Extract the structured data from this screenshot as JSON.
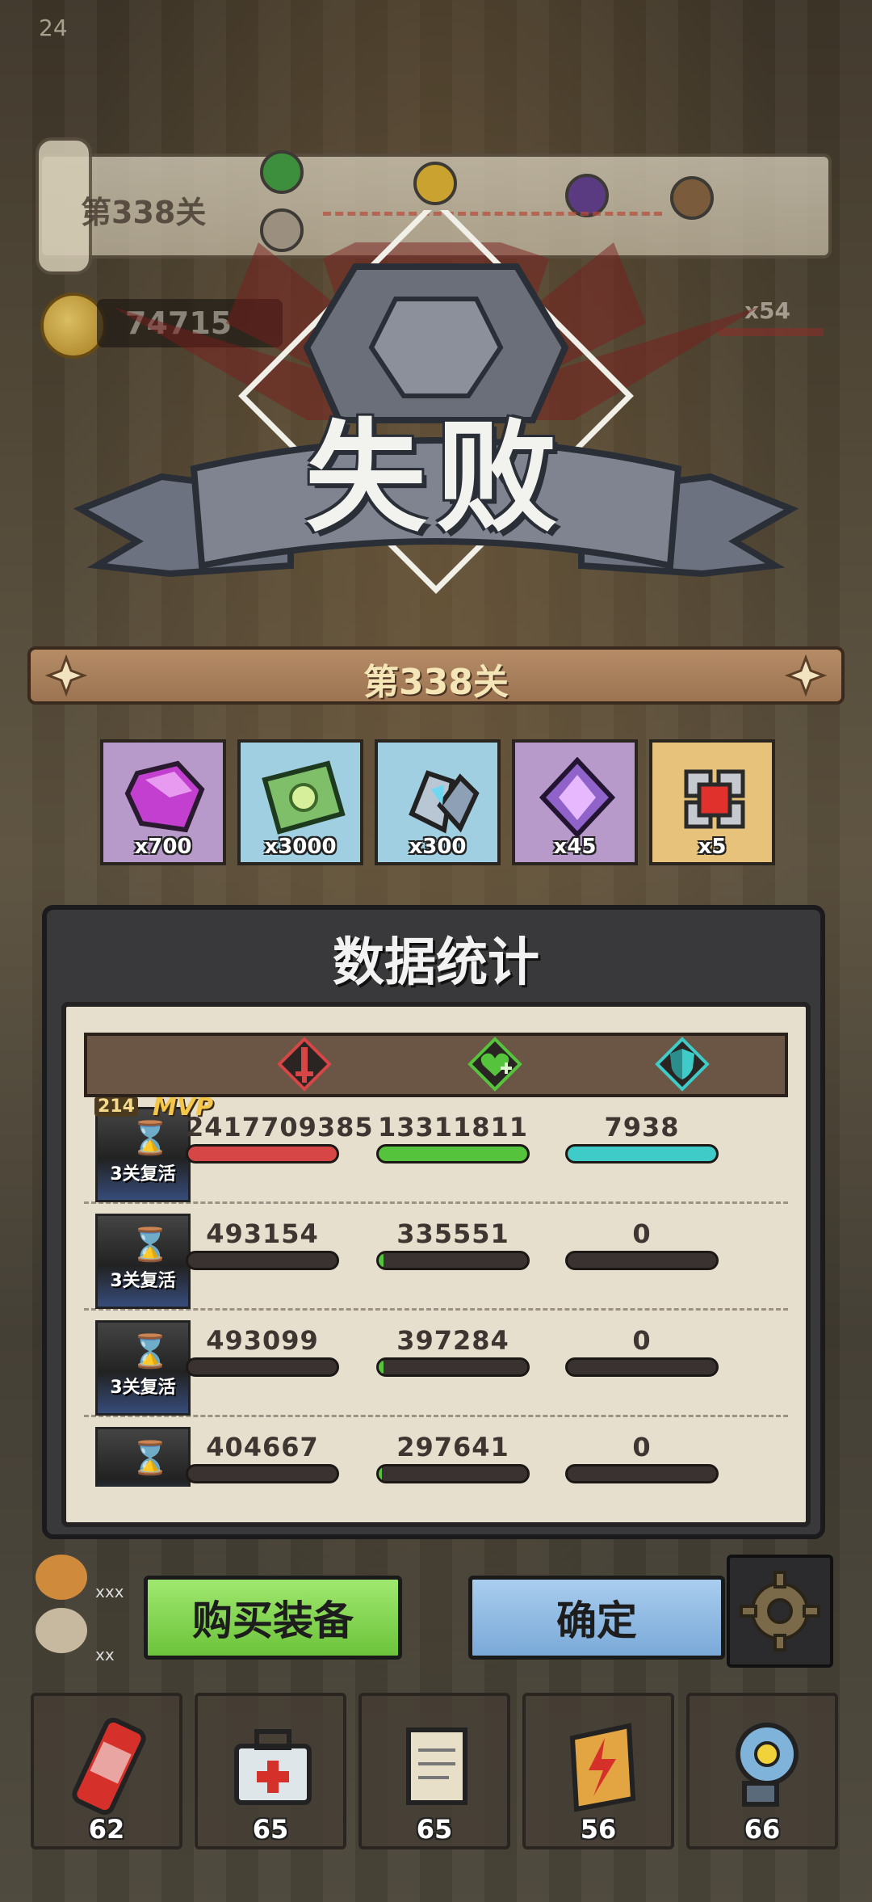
{
  "hud": {
    "corner_number": "24"
  },
  "stage_banner": {
    "label": "第338关"
  },
  "gold": {
    "value": "74715",
    "multiplier": "x54"
  },
  "result": {
    "title": "失败"
  },
  "level": {
    "label": "第338关"
  },
  "rewards": [
    {
      "icon": "purple-gem-icon",
      "count": "x700",
      "bg": "#b79ac9"
    },
    {
      "icon": "cash-icon",
      "count": "x3000",
      "bg": "#9fcfe0"
    },
    {
      "icon": "crystal-shard-icon",
      "count": "x300",
      "bg": "#9fcfe0"
    },
    {
      "icon": "violet-crystal-icon",
      "count": "x45",
      "bg": "#b79ac9"
    },
    {
      "icon": "cube-core-icon",
      "count": "x5",
      "bg": "#e6c27a"
    }
  ],
  "stats": {
    "title": "数据统计",
    "columns": [
      {
        "icon": "sword-icon",
        "color": "#d64646"
      },
      {
        "icon": "heal-heart-icon",
        "color": "#55c43c"
      },
      {
        "icon": "shield-icon",
        "color": "#3fcbc7"
      }
    ],
    "rows": [
      {
        "revive": "3关复活",
        "mvp": "MVP",
        "level": "214",
        "damage": "2417709385",
        "heal": "13311811",
        "shield": "7938",
        "damage_fill": 1.0,
        "heal_fill": 1.0,
        "shield_fill": 1.0
      },
      {
        "revive": "3关复活",
        "damage": "493154",
        "heal": "335551",
        "shield": "0",
        "damage_fill": 0.0,
        "heal_fill": 0.03,
        "shield_fill": 0.0
      },
      {
        "revive": "3关复活",
        "damage": "493099",
        "heal": "397284",
        "shield": "0",
        "damage_fill": 0.0,
        "heal_fill": 0.03,
        "shield_fill": 0.0
      },
      {
        "revive": "",
        "damage": "404667",
        "heal": "297641",
        "shield": "0",
        "damage_fill": 0.0,
        "heal_fill": 0.02,
        "shield_fill": 0.0
      }
    ]
  },
  "buttons": {
    "buy": "购买装备",
    "confirm": "确定"
  },
  "pets": [
    {
      "name": "xxx"
    },
    {
      "name": "xx"
    }
  ],
  "items": [
    {
      "icon": "cola-can-icon",
      "count": "62"
    },
    {
      "icon": "first-aid-kit-icon",
      "count": "65"
    },
    {
      "icon": "scroll-icon",
      "count": "65"
    },
    {
      "icon": "lightning-card-icon",
      "count": "56"
    },
    {
      "icon": "radiation-capsule-icon",
      "count": "66"
    }
  ]
}
